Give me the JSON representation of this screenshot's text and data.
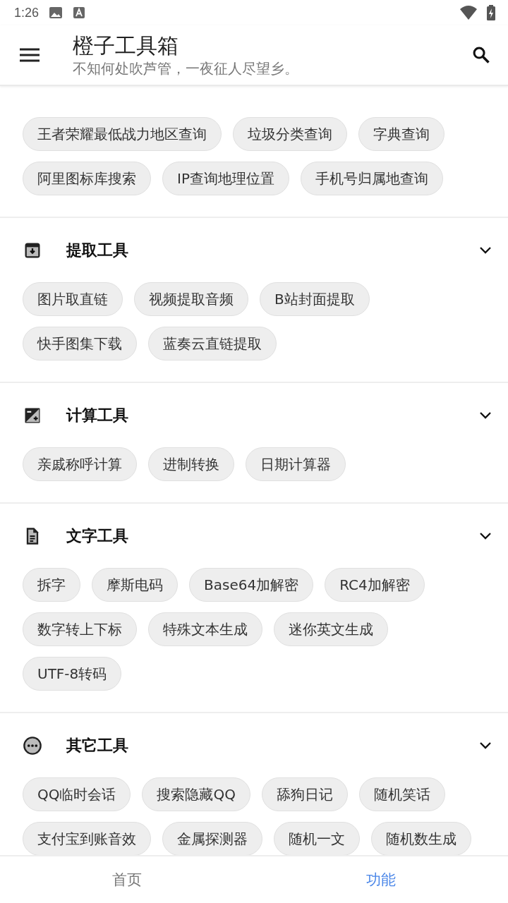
{
  "status_bar": {
    "time": "1:26"
  },
  "app_bar": {
    "title": "橙子工具箱",
    "subtitle": "不知何处吹芦管，一夜征人尽望乡。"
  },
  "sections": [
    {
      "expanded": true,
      "tools": [
        "王者荣耀最低战力地区查询",
        "垃圾分类查询",
        "字典查询",
        "阿里图标库搜索",
        "IP查询地理位置",
        "手机号归属地查询"
      ]
    },
    {
      "kind": "extract",
      "title": "提取工具",
      "expanded": true,
      "tools": [
        "图片取直链",
        "视频提取音频",
        "B站封面提取",
        "快手图集下载",
        "蓝奏云直链提取"
      ]
    },
    {
      "kind": "calculate",
      "title": "计算工具",
      "expanded": true,
      "tools": [
        "亲戚称呼计算",
        "进制转换",
        "日期计算器"
      ]
    },
    {
      "kind": "text",
      "title": "文字工具",
      "expanded": true,
      "tools": [
        "拆字",
        "摩斯电码",
        "Base64加解密",
        "RC4加解密",
        "数字转上下标",
        "特殊文本生成",
        "迷你英文生成",
        "UTF-8转码"
      ]
    },
    {
      "kind": "other",
      "title": "其它工具",
      "expanded": true,
      "tools": [
        "QQ临时会话",
        "搜索隐藏QQ",
        "舔狗日记",
        "随机笑话",
        "支付宝到账音效",
        "金属探测器",
        "随机一文",
        "随机数生成"
      ]
    }
  ],
  "bottom_nav": [
    {
      "label": "首页",
      "selected": false
    },
    {
      "label": "功能",
      "selected": true
    }
  ]
}
